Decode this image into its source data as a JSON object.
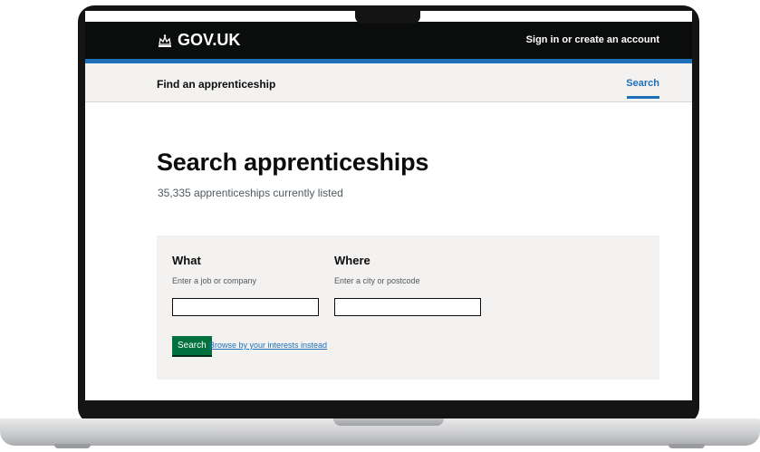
{
  "header": {
    "logo_text": "GOV.UK",
    "logo_icon": "crown-icon",
    "sign_in_link": "Sign in or create an account"
  },
  "service_nav": {
    "service_name": "Find an apprenticeship",
    "active_item": "Search"
  },
  "main": {
    "title": "Search apprenticeships",
    "listed_count": "35,335 apprenticeships currently listed"
  },
  "search_form": {
    "what": {
      "label": "What",
      "hint": "Enter a job or company",
      "value": ""
    },
    "where": {
      "label": "Where",
      "hint": "Enter a city or postcode",
      "value": ""
    },
    "search_button": "Search",
    "browse_link": "Browse by your interests instead"
  },
  "colors": {
    "header_bg": "#0b0c0c",
    "accent_blue": "#1d70b8",
    "button_green": "#00703c",
    "panel_bg": "#f3f2f1"
  }
}
